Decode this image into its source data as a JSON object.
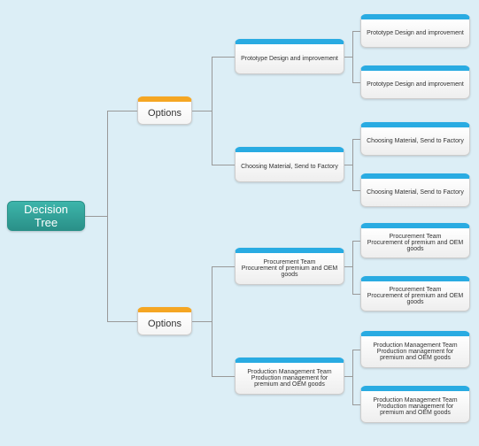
{
  "root": {
    "label": "Decision Tree"
  },
  "level1": [
    {
      "label": "Options"
    },
    {
      "label": "Options"
    }
  ],
  "level2": [
    {
      "label": "Prototype Design and improvement"
    },
    {
      "label": "Choosing Material, Send to Factory"
    },
    {
      "label": "Procurement Team\nProcurement of premium and OEM goods"
    },
    {
      "label": "Production Management Team\nProduction management for premium and OEM goods"
    }
  ],
  "level3": [
    {
      "label": "Prototype Design and improvement"
    },
    {
      "label": "Prototype Design and improvement"
    },
    {
      "label": "Choosing Material, Send to Factory"
    },
    {
      "label": "Choosing Material, Send to Factory"
    },
    {
      "label": "Procurement Team\nProcurement of premium and OEM goods"
    },
    {
      "label": "Procurement Team\nProcurement of premium and OEM goods"
    },
    {
      "label": "Production Management Team\nProduction management for premium and OEM goods"
    },
    {
      "label": "Production Management Team\nProduction management for premium and OEM goods"
    }
  ]
}
